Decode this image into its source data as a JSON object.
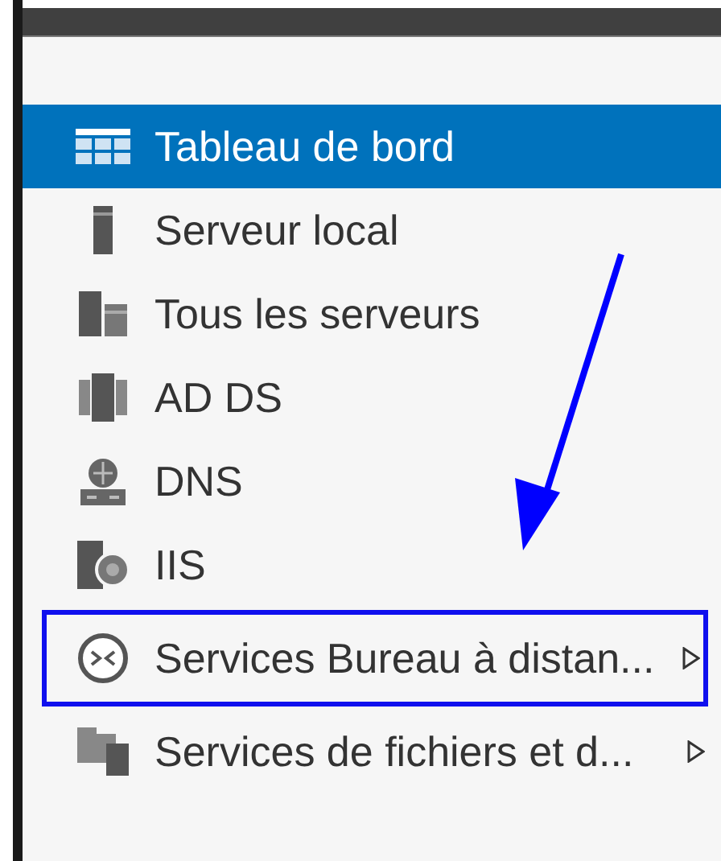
{
  "sidebar": {
    "items": [
      {
        "label": "Tableau de bord",
        "kind": "dashboard",
        "selected": true,
        "has_submenu": false,
        "highlighted": false
      },
      {
        "label": "Serveur local",
        "kind": "server",
        "selected": false,
        "has_submenu": false,
        "highlighted": false
      },
      {
        "label": "Tous les serveurs",
        "kind": "servers",
        "selected": false,
        "has_submenu": false,
        "highlighted": false
      },
      {
        "label": "AD DS",
        "kind": "adds",
        "selected": false,
        "has_submenu": false,
        "highlighted": false
      },
      {
        "label": "DNS",
        "kind": "dns",
        "selected": false,
        "has_submenu": false,
        "highlighted": false
      },
      {
        "label": "IIS",
        "kind": "iis",
        "selected": false,
        "has_submenu": false,
        "highlighted": false
      },
      {
        "label": "Services Bureau à distan...",
        "kind": "remote",
        "selected": false,
        "has_submenu": true,
        "highlighted": true
      },
      {
        "label": "Services de fichiers et d...",
        "kind": "files",
        "selected": false,
        "has_submenu": true,
        "highlighted": false
      }
    ]
  }
}
